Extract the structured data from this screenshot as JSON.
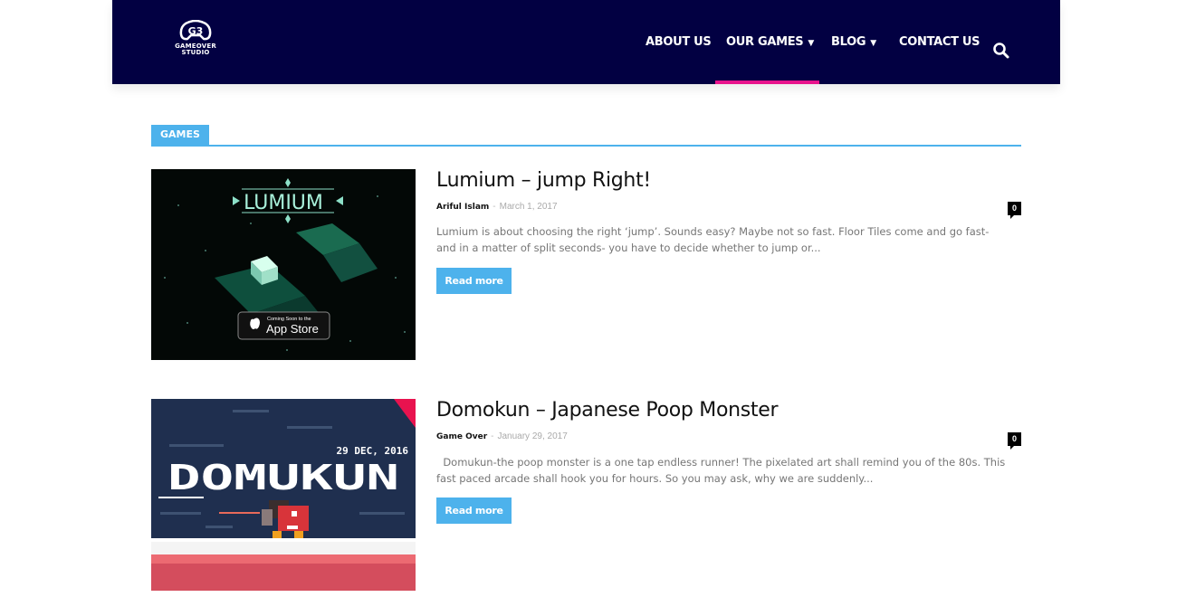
{
  "header": {
    "logo": {
      "line1": "GAMEOVER",
      "line2": "STUDIO"
    },
    "nav": [
      {
        "label": "ABOUT US",
        "has_dropdown": false
      },
      {
        "label": "OUR GAMES",
        "has_dropdown": true,
        "active": true
      },
      {
        "label": "BLOG",
        "has_dropdown": true
      },
      {
        "label": "CONTACT US",
        "has_dropdown": false
      }
    ],
    "search_icon": "search-icon",
    "colors": {
      "background": "#020042",
      "active_underline": "#e8138c"
    }
  },
  "section": {
    "label": "GAMES",
    "accent": "#4db2ec"
  },
  "posts": [
    {
      "title": "Lumium – jump Right!",
      "author": "Ariful Islam",
      "date": "March 1, 2017",
      "comments": "0",
      "excerpt": "Lumium is about choosing the right ‘jump’. Sounds easy? Maybe not so fast. Floor Tiles come and go fast- and in a matter of split seconds- you have to decide whether to jump or...",
      "read_more": "Read more",
      "thumb": {
        "logo": "LUMIUM",
        "badge_small": "Coming Soon to the",
        "badge_big": "App Store"
      }
    },
    {
      "title": "Domokun – Japanese Poop Monster",
      "author": "Game Over",
      "date": "January 29, 2017",
      "comments": "0",
      "excerpt": "  Domukun-the poop monster is a one tap endless runner! The pixelated art shall remind you of the 80s. This fast paced arcade shall hook you for hours. So you may ask, why we are suddenly...",
      "read_more": "Read more",
      "thumb": {
        "date": "29 DEC, 2016",
        "logo": "DOMUKUN"
      }
    }
  ]
}
